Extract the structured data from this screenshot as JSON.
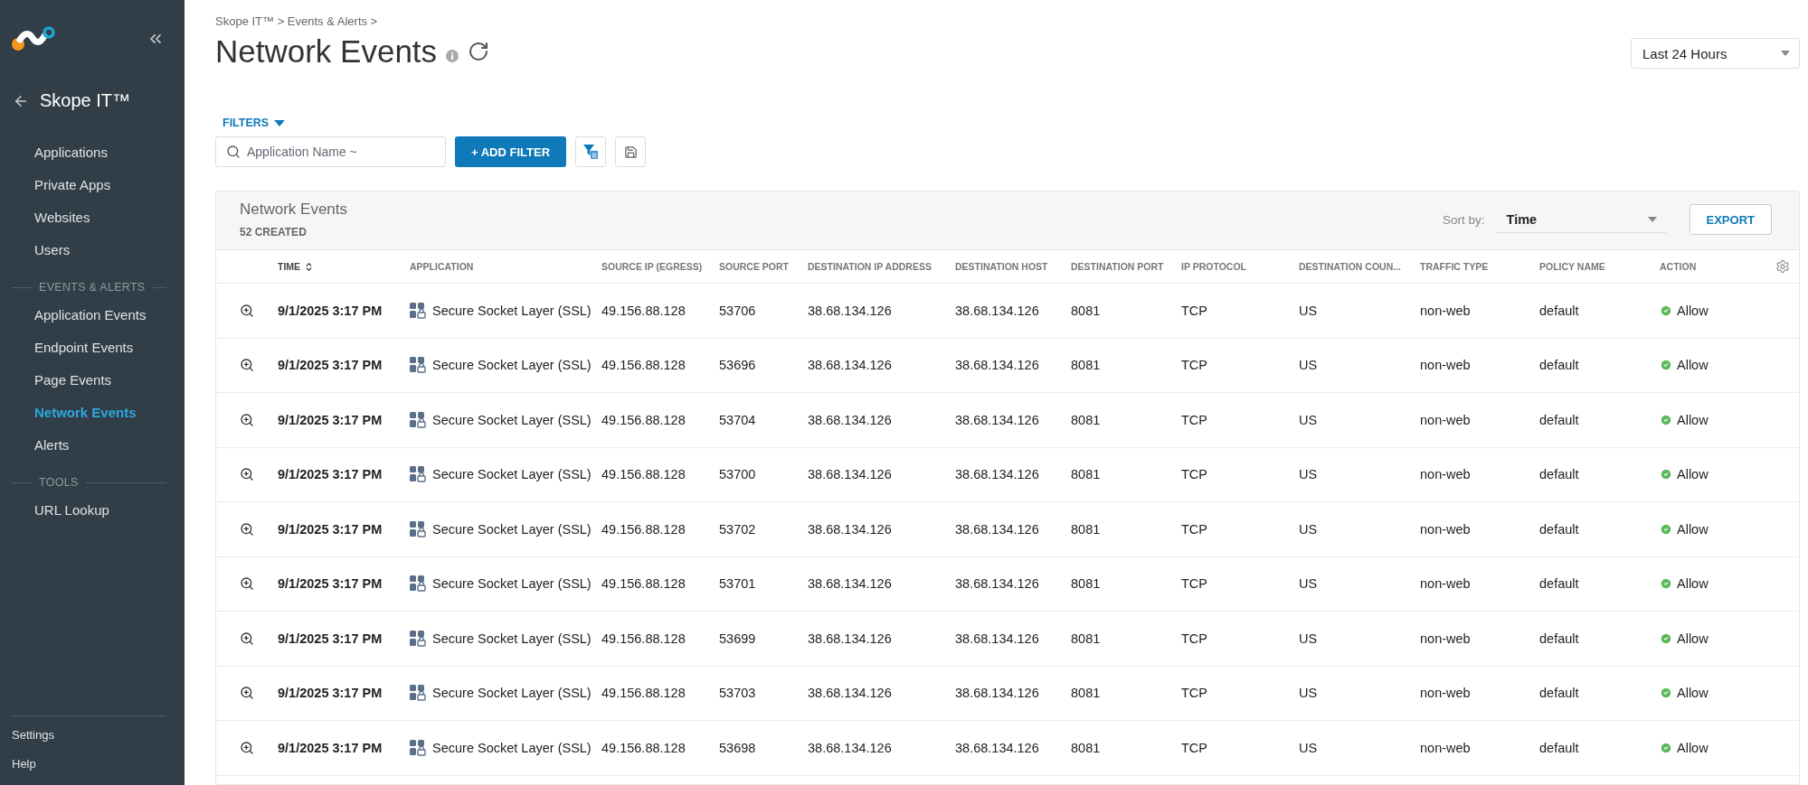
{
  "sidebar": {
    "title": "Skope IT™",
    "nav_groups": [
      {
        "items": [
          {
            "label": "Applications",
            "selected": false
          },
          {
            "label": "Private Apps",
            "selected": false
          },
          {
            "label": "Websites",
            "selected": false
          },
          {
            "label": "Users",
            "selected": false
          }
        ]
      },
      {
        "heading": "EVENTS & ALERTS",
        "items": [
          {
            "label": "Application Events",
            "selected": false
          },
          {
            "label": "Endpoint Events",
            "selected": false
          },
          {
            "label": "Page Events",
            "selected": false
          },
          {
            "label": "Network Events",
            "selected": true
          },
          {
            "label": "Alerts",
            "selected": false
          }
        ]
      },
      {
        "heading": "TOOLS",
        "items": [
          {
            "label": "URL Lookup",
            "selected": false
          }
        ]
      }
    ],
    "footer_links": [
      "Settings",
      "Help"
    ]
  },
  "breadcrumb": "Skope IT™ > Events & Alerts >",
  "page_title": "Network Events",
  "time_range": "Last 24 Hours",
  "filters": {
    "label": "FILTERS",
    "placeholder": "Application Name ~",
    "add_button": "+ ADD FILTER"
  },
  "table": {
    "title": "Network Events",
    "count": "52 CREATED",
    "sort_label": "Sort by:",
    "sort_value": "Time",
    "export_button": "EXPORT",
    "columns": [
      {
        "label": "TIME",
        "sorted": true
      },
      {
        "label": "APPLICATION",
        "sorted": false
      },
      {
        "label": "SOURCE IP (EGRESS)",
        "sorted": false
      },
      {
        "label": "SOURCE PORT",
        "sorted": false
      },
      {
        "label": "DESTINATION IP ADDRESS",
        "sorted": false
      },
      {
        "label": "DESTINATION HOST",
        "sorted": false
      },
      {
        "label": "DESTINATION PORT",
        "sorted": false
      },
      {
        "label": "IP PROTOCOL",
        "sorted": false
      },
      {
        "label": "DESTINATION COUN...",
        "sorted": false
      },
      {
        "label": "TRAFFIC TYPE",
        "sorted": false
      },
      {
        "label": "POLICY NAME",
        "sorted": false
      },
      {
        "label": "ACTION",
        "sorted": false
      }
    ],
    "rows": [
      {
        "time": "9/1/2025 3:17 PM",
        "application": "Secure Socket Layer (SSL)",
        "source_ip": "49.156.88.128",
        "source_port": "53706",
        "destination_ip": "38.68.134.126",
        "destination_host": "38.68.134.126",
        "destination_port": "8081",
        "ip_protocol": "TCP",
        "destination_country": "US",
        "traffic_type": "non-web",
        "policy_name": "default",
        "action": "Allow"
      },
      {
        "time": "9/1/2025 3:17 PM",
        "application": "Secure Socket Layer (SSL)",
        "source_ip": "49.156.88.128",
        "source_port": "53696",
        "destination_ip": "38.68.134.126",
        "destination_host": "38.68.134.126",
        "destination_port": "8081",
        "ip_protocol": "TCP",
        "destination_country": "US",
        "traffic_type": "non-web",
        "policy_name": "default",
        "action": "Allow"
      },
      {
        "time": "9/1/2025 3:17 PM",
        "application": "Secure Socket Layer (SSL)",
        "source_ip": "49.156.88.128",
        "source_port": "53704",
        "destination_ip": "38.68.134.126",
        "destination_host": "38.68.134.126",
        "destination_port": "8081",
        "ip_protocol": "TCP",
        "destination_country": "US",
        "traffic_type": "non-web",
        "policy_name": "default",
        "action": "Allow"
      },
      {
        "time": "9/1/2025 3:17 PM",
        "application": "Secure Socket Layer (SSL)",
        "source_ip": "49.156.88.128",
        "source_port": "53700",
        "destination_ip": "38.68.134.126",
        "destination_host": "38.68.134.126",
        "destination_port": "8081",
        "ip_protocol": "TCP",
        "destination_country": "US",
        "traffic_type": "non-web",
        "policy_name": "default",
        "action": "Allow"
      },
      {
        "time": "9/1/2025 3:17 PM",
        "application": "Secure Socket Layer (SSL)",
        "source_ip": "49.156.88.128",
        "source_port": "53702",
        "destination_ip": "38.68.134.126",
        "destination_host": "38.68.134.126",
        "destination_port": "8081",
        "ip_protocol": "TCP",
        "destination_country": "US",
        "traffic_type": "non-web",
        "policy_name": "default",
        "action": "Allow"
      },
      {
        "time": "9/1/2025 3:17 PM",
        "application": "Secure Socket Layer (SSL)",
        "source_ip": "49.156.88.128",
        "source_port": "53701",
        "destination_ip": "38.68.134.126",
        "destination_host": "38.68.134.126",
        "destination_port": "8081",
        "ip_protocol": "TCP",
        "destination_country": "US",
        "traffic_type": "non-web",
        "policy_name": "default",
        "action": "Allow"
      },
      {
        "time": "9/1/2025 3:17 PM",
        "application": "Secure Socket Layer (SSL)",
        "source_ip": "49.156.88.128",
        "source_port": "53699",
        "destination_ip": "38.68.134.126",
        "destination_host": "38.68.134.126",
        "destination_port": "8081",
        "ip_protocol": "TCP",
        "destination_country": "US",
        "traffic_type": "non-web",
        "policy_name": "default",
        "action": "Allow"
      },
      {
        "time": "9/1/2025 3:17 PM",
        "application": "Secure Socket Layer (SSL)",
        "source_ip": "49.156.88.128",
        "source_port": "53703",
        "destination_ip": "38.68.134.126",
        "destination_host": "38.68.134.126",
        "destination_port": "8081",
        "ip_protocol": "TCP",
        "destination_country": "US",
        "traffic_type": "non-web",
        "policy_name": "default",
        "action": "Allow"
      },
      {
        "time": "9/1/2025 3:17 PM",
        "application": "Secure Socket Layer (SSL)",
        "source_ip": "49.156.88.128",
        "source_port": "53698",
        "destination_ip": "38.68.134.126",
        "destination_host": "38.68.134.126",
        "destination_port": "8081",
        "ip_protocol": "TCP",
        "destination_country": "US",
        "traffic_type": "non-web",
        "policy_name": "default",
        "action": "Allow"
      }
    ]
  }
}
